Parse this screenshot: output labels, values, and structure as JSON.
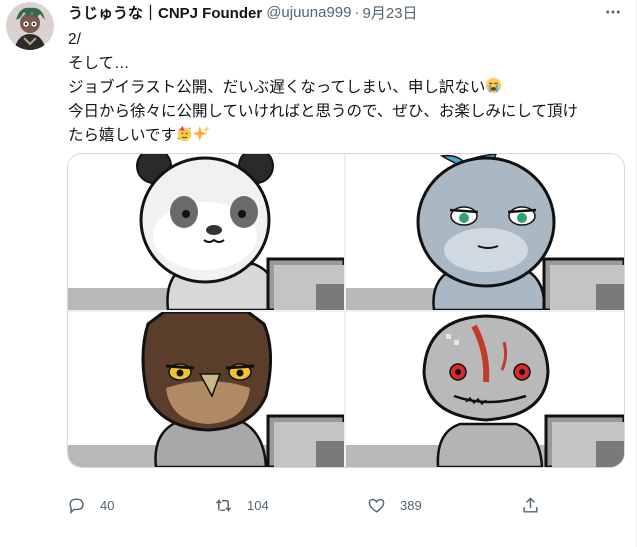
{
  "tweet": {
    "author_name": "うじゅうな｜CNPJ Founder",
    "handle": "@ujuuna999",
    "separator": "·",
    "date": "9月23日",
    "text_lines": [
      "2/",
      "そして…",
      "ジョブイラスト公開、だいぶ遅くなってしまい、申し訳ない",
      "今日から徐々に公開していければと思うので、ぜひ、お楽しみにして頂け",
      "たら嬉しいです"
    ],
    "emoji": [
      "loudly-crying-face",
      "partying-face",
      "sparkles"
    ]
  },
  "media": {
    "images": [
      {
        "subject": "panda-character-at-computer"
      },
      {
        "subject": "gray-blue-creature-at-computer"
      },
      {
        "subject": "brown-owl-character-at-computer"
      },
      {
        "subject": "gray-lizard-with-red-marks-at-computer"
      }
    ]
  },
  "actions": {
    "reply_count": "40",
    "retweet_count": "104",
    "like_count": "389"
  },
  "icons": {
    "more": "more-horizontal-icon",
    "reply": "reply-icon",
    "retweet": "retweet-icon",
    "like": "heart-icon",
    "share": "share-icon"
  },
  "colors": {
    "text_primary": "#0f1419",
    "text_secondary": "#536471",
    "border": "#cfd9de"
  }
}
